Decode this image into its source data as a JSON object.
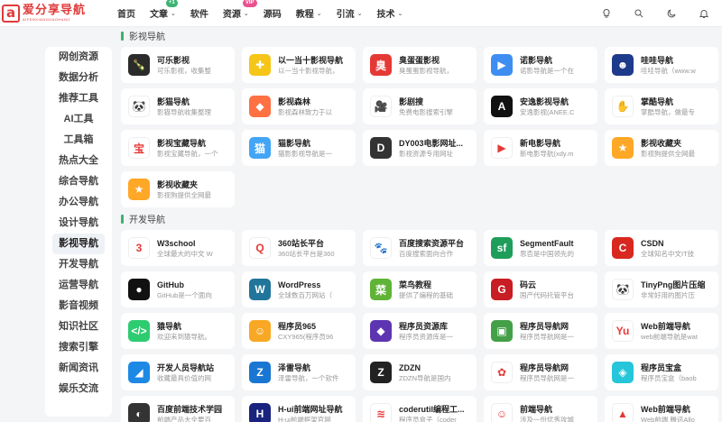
{
  "header": {
    "logo_mark": "a",
    "logo_title": "爱分享导航",
    "logo_sub": "AIFENXIANGDAOHANG",
    "nav": [
      {
        "label": "首页",
        "chevron": false,
        "badge": ""
      },
      {
        "label": "文章",
        "chevron": true,
        "badge": "+1",
        "badge_color": "green"
      },
      {
        "label": "软件",
        "chevron": false,
        "badge": ""
      },
      {
        "label": "资源",
        "chevron": true,
        "badge": "VIP",
        "badge_color": "red"
      },
      {
        "label": "源码",
        "chevron": false,
        "badge": ""
      },
      {
        "label": "教程",
        "chevron": true,
        "badge": ""
      },
      {
        "label": "引流",
        "chevron": true,
        "badge": ""
      },
      {
        "label": "技术",
        "chevron": true,
        "badge": ""
      }
    ],
    "icons": [
      "lightbulb-icon",
      "search-icon",
      "moon-icon",
      "bell-icon"
    ]
  },
  "sidebar": {
    "items": [
      {
        "label": "网创资源",
        "active": false
      },
      {
        "label": "数据分析",
        "active": false
      },
      {
        "label": "推荐工具",
        "active": false
      },
      {
        "label": "AI工具",
        "active": false
      },
      {
        "label": "工具箱",
        "active": false
      },
      {
        "label": "热点大全",
        "active": false
      },
      {
        "label": "综合导航",
        "active": false
      },
      {
        "label": "办公导航",
        "active": false
      },
      {
        "label": "设计导航",
        "active": false
      },
      {
        "label": "影视导航",
        "active": true
      },
      {
        "label": "开发导航",
        "active": false
      },
      {
        "label": "运营导航",
        "active": false
      },
      {
        "label": "影音视频",
        "active": false
      },
      {
        "label": "知识社区",
        "active": false
      },
      {
        "label": "搜索引擎",
        "active": false
      },
      {
        "label": "新闻资讯",
        "active": false
      },
      {
        "label": "娱乐交流",
        "active": false
      }
    ]
  },
  "sections": [
    {
      "title": "影视导航",
      "cards": [
        {
          "name": "可乐影视",
          "desc": "可乐影视，收集整",
          "icon": "cola-icon",
          "bg": "#2b2b2b",
          "glyph": "🍾"
        },
        {
          "name": "以一当十影视导航",
          "desc": "以一当十影视导航，",
          "icon": "plus-icon",
          "bg": "#f5c518",
          "glyph": "✚"
        },
        {
          "name": "臭蛋蛋影视",
          "desc": "臭蛋蛋影视导航，",
          "icon": "chou-icon",
          "bg": "#e53935",
          "glyph": "臭"
        },
        {
          "name": "诺影导航",
          "desc": "诺影导航是一个在",
          "icon": "play-icon",
          "bg": "#3d8ef0",
          "glyph": "▶"
        },
        {
          "name": "哇哇导航",
          "desc": "哇哇导航（www.w",
          "icon": "face-icon",
          "bg": "#1e3a8a",
          "glyph": "☻"
        },
        {
          "name": "影猫导航",
          "desc": "影猫导航收集整理",
          "icon": "panda-icon",
          "bg": "#ffffff",
          "glyph": "🐼"
        },
        {
          "name": "影视森林",
          "desc": "影视森林致力于以",
          "icon": "forest-icon",
          "bg": "#ff7043",
          "glyph": "◆"
        },
        {
          "name": "影剧搜",
          "desc": "免费电影搜索引擎",
          "icon": "camera-icon",
          "bg": "#ffffff",
          "glyph": "🎥"
        },
        {
          "name": "安逸影视导航",
          "desc": "安逸影视(ANEE.C",
          "icon": "a-letter-icon",
          "bg": "#111111",
          "glyph": "A"
        },
        {
          "name": "掌酷导航",
          "desc": "掌酷导航，做最专",
          "icon": "hand-icon",
          "bg": "#ffffff",
          "glyph": "✋"
        },
        {
          "name": "影视宝藏导航",
          "desc": "影视宝藏导航，一个",
          "icon": "bao-icon",
          "bg": "#ffffff",
          "glyph": "宝"
        },
        {
          "name": "猫影导航",
          "desc": "猫影影视导航是一",
          "icon": "cat-icon",
          "bg": "#42a5f5",
          "glyph": "猫"
        },
        {
          "name": "DY003电影网址...",
          "desc": "影视资源专用网址",
          "icon": "dy-icon",
          "bg": "#333333",
          "glyph": "D"
        },
        {
          "name": "新电影导航",
          "desc": "新电影导航(xdy.m",
          "icon": "film-icon",
          "bg": "#ffffff",
          "glyph": "▶"
        },
        {
          "name": "影视收藏夹",
          "desc": "影视狗提供全网最",
          "icon": "bookmark-icon",
          "bg": "#ffa726",
          "glyph": "★"
        },
        {
          "name": "影视收藏夹",
          "desc": "影视狗提供全网最",
          "icon": "bookmark-icon",
          "bg": "#ffa726",
          "glyph": "★"
        }
      ]
    },
    {
      "title": "开发导航",
      "cards": [
        {
          "name": "W3school",
          "desc": "全球最大的中文 W",
          "icon": "w3-icon",
          "bg": "#ffffff",
          "glyph": "3"
        },
        {
          "name": "360站长平台",
          "desc": "360站长平台是360",
          "icon": "q360-icon",
          "bg": "#ffffff",
          "glyph": "Q"
        },
        {
          "name": "百度搜索资源平台",
          "desc": "百度搜索面向合作",
          "icon": "baidu-icon",
          "bg": "#ffffff",
          "glyph": "🐾"
        },
        {
          "name": "SegmentFault",
          "desc": "思否是中国领先的",
          "icon": "sf-icon",
          "bg": "#1e9e5a",
          "glyph": "sf"
        },
        {
          "name": "CSDN",
          "desc": "全球知名中文IT技",
          "icon": "csdn-icon",
          "bg": "#d8281f",
          "glyph": "C"
        },
        {
          "name": "GitHub",
          "desc": "GitHub是一个面向",
          "icon": "github-icon",
          "bg": "#111111",
          "glyph": "●"
        },
        {
          "name": "WordPress",
          "desc": "全球数百万网站（",
          "icon": "wordpress-icon",
          "bg": "#21759b",
          "glyph": "W"
        },
        {
          "name": "菜鸟教程",
          "desc": "提供了编程的基础",
          "icon": "runoob-icon",
          "bg": "#5fb336",
          "glyph": "菜"
        },
        {
          "name": "码云",
          "desc": "国产代码托管平台",
          "icon": "gitee-icon",
          "bg": "#c71d23",
          "glyph": "G"
        },
        {
          "name": "TinyPng图片压缩",
          "desc": "非常好用的图片压",
          "icon": "tinypng-icon",
          "bg": "#ffffff",
          "glyph": "🐼"
        },
        {
          "name": "猿导航",
          "desc": "欢迎来到猿导航。",
          "icon": "code-icon",
          "bg": "#2ecc71",
          "glyph": "</>"
        },
        {
          "name": "程序员965",
          "desc": "CXY965(程序员96",
          "icon": "monkey-icon",
          "bg": "#f9a825",
          "glyph": "☺"
        },
        {
          "name": "程序员资源库",
          "desc": "程序员资源库是一",
          "icon": "cube-icon",
          "bg": "#5e35b1",
          "glyph": "◆"
        },
        {
          "name": "程序员导航网",
          "desc": "程序员导航网是一",
          "icon": "box-icon",
          "bg": "#43a047",
          "glyph": "▣"
        },
        {
          "name": "Web前端导航",
          "desc": "web前端导航是wat",
          "icon": "yu-icon",
          "bg": "#ffffff",
          "glyph": "Yu"
        },
        {
          "name": "开发人员导航站",
          "desc": "收藏最具价值的网",
          "icon": "dev-icon",
          "bg": "#1e88e5",
          "glyph": "◢"
        },
        {
          "name": "泽雷导航",
          "desc": "泽雷导航，一个软件",
          "icon": "z-icon",
          "bg": "#1976d2",
          "glyph": "Z"
        },
        {
          "name": "ZDZN",
          "desc": "ZDZN导航是国内",
          "icon": "zdzn-icon",
          "bg": "#222222",
          "glyph": "Z"
        },
        {
          "name": "程序员导航网",
          "desc": "程序员导航网是一",
          "icon": "flower-icon",
          "bg": "#ffffff",
          "glyph": "✿"
        },
        {
          "name": "程序员宝盒",
          "desc": "程序员宝盒（baob",
          "icon": "gem-icon",
          "bg": "#26c6da",
          "glyph": "◈"
        },
        {
          "name": "百度前端技术学园",
          "desc": "前端产品大全要百",
          "icon": "ife-icon",
          "bg": "#333333",
          "glyph": "◐"
        },
        {
          "name": "H-ui前端网址导航",
          "desc": "H-ui前端框架官网",
          "icon": "hui-icon",
          "bg": "#1a237e",
          "glyph": "H"
        },
        {
          "name": "coderutil编程工...",
          "desc": "程序员盒子（coder",
          "icon": "coderutil-icon",
          "bg": "#ffffff",
          "glyph": "≋"
        },
        {
          "name": "前端导航",
          "desc": "涉及一份优秀攻城",
          "icon": "robot-icon",
          "bg": "#ffffff",
          "glyph": "☺"
        },
        {
          "name": "Web前端导航",
          "desc": "Web前端 腾讯Allo",
          "icon": "alloy-icon",
          "bg": "#ffffff",
          "glyph": "▲"
        }
      ]
    }
  ]
}
